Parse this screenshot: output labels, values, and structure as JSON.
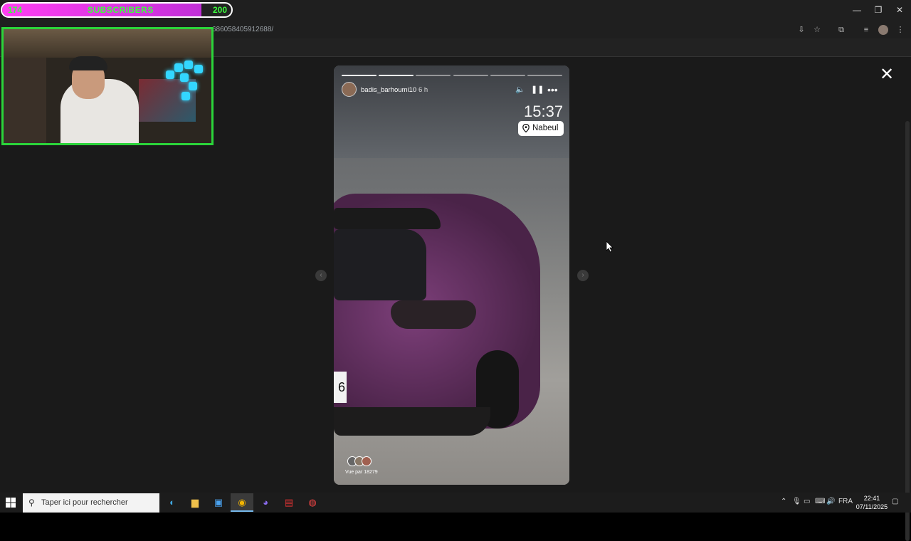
{
  "browser": {
    "url_fragment": "686058405912688/",
    "window_controls": [
      "minimize-icon",
      "restore-icon",
      "close-icon"
    ],
    "toolbar_icons": [
      "install-icon",
      "star-icon",
      "extensions-icon",
      "media-icon",
      "profile-avatar",
      "menu-icon"
    ]
  },
  "overlay": {
    "subscribers": {
      "current": "174",
      "label": "SUBSCRIBERS",
      "goal": "200",
      "progress": 0.87
    }
  },
  "story": {
    "username": "badis_barhoumi10",
    "posted": "6 h",
    "segments_total": 6,
    "segments_done": 2,
    "clock_sticker": "15:37",
    "location_sticker": "Nabeul",
    "plate_visible": "6",
    "viewers_label": "Vue par 18279"
  },
  "taskbar": {
    "search_placeholder": "Taper ici pour rechercher",
    "language": "FRA",
    "time": "22:41",
    "date": "07/11/2025"
  },
  "colors": {
    "overlay_accent": "#2bd43a",
    "subscriber_fill": "#ff3ff2",
    "subscriber_text": "#3dff3d",
    "page_bg": "#1a1a1a"
  }
}
